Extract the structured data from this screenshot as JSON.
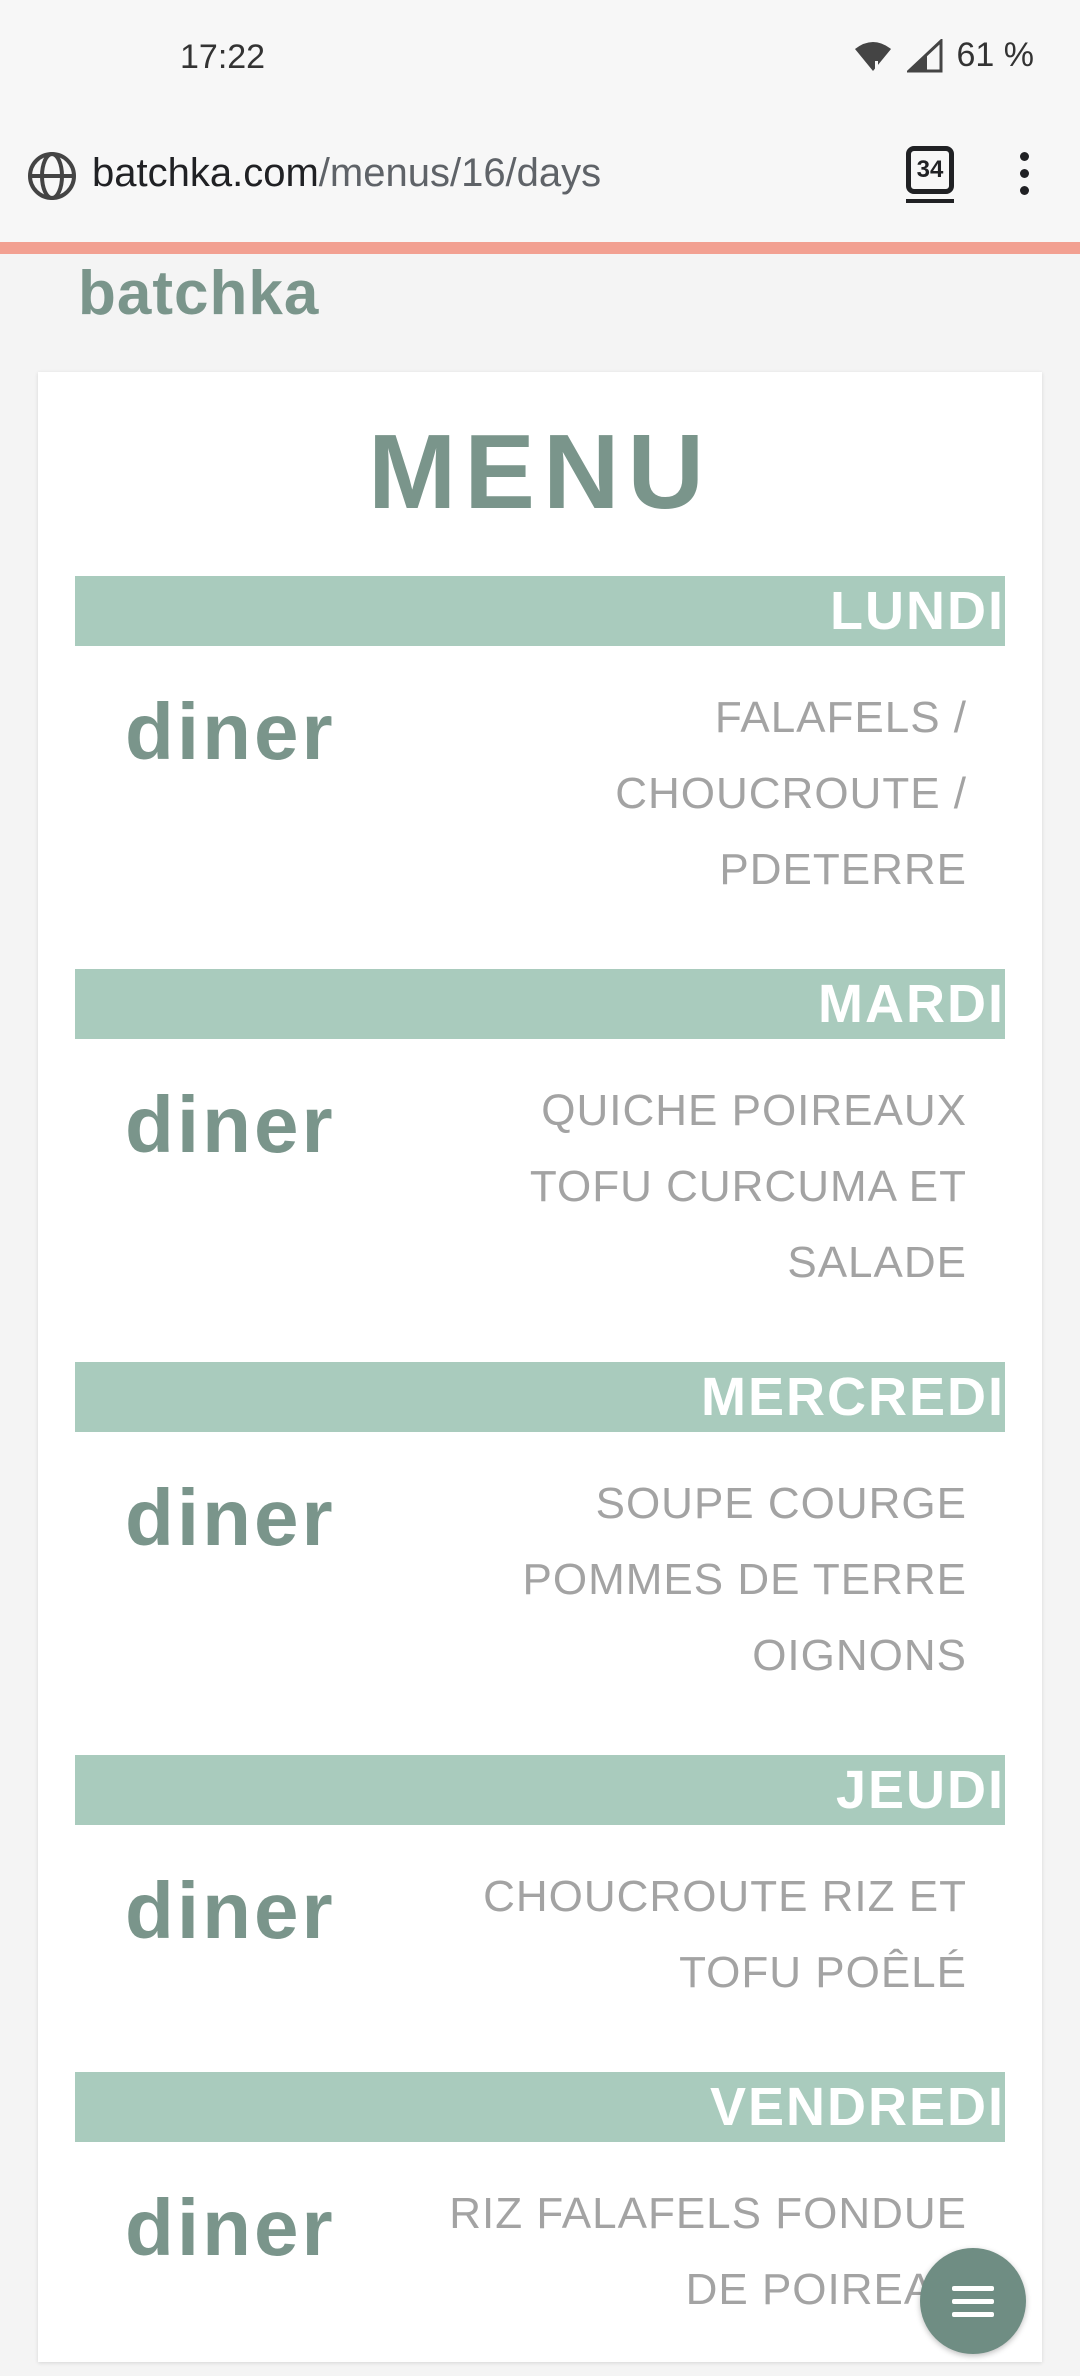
{
  "status_bar": {
    "time": "17:22",
    "battery": "61 %"
  },
  "browser": {
    "url_domain": "batchka.com",
    "url_path": "/menus/16/days",
    "tab_count": "34"
  },
  "page": {
    "brand": "batchka",
    "title": "MENU",
    "days": [
      {
        "day": "LUNDI",
        "meal": "diner",
        "dish_lines": [
          "FALAFELS /",
          "CHOUCROUTE /",
          "PDETERRE"
        ]
      },
      {
        "day": "MARDI",
        "meal": "diner",
        "dish_lines": [
          "QUICHE POIREAUX",
          "TOFU CURCUMA ET",
          "SALADE"
        ]
      },
      {
        "day": "MERCREDI",
        "meal": "diner",
        "dish_lines": [
          "SOUPE COURGE",
          "POMMES DE TERRE",
          "OIGNONS"
        ]
      },
      {
        "day": "JEUDI",
        "meal": "diner",
        "dish_lines": [
          "CHOUCROUTE RIZ ET",
          "TOFU POÊLÉ"
        ]
      },
      {
        "day": "VENDREDI",
        "meal": "diner",
        "dish_lines": [
          "RIZ FALAFELS FONDUE",
          "DE POIREAU"
        ]
      }
    ]
  },
  "colors": {
    "accent": "#7a958b",
    "day_bar": "#a9cbbd",
    "progress": "#f2a091",
    "fab": "#6f8d83"
  }
}
